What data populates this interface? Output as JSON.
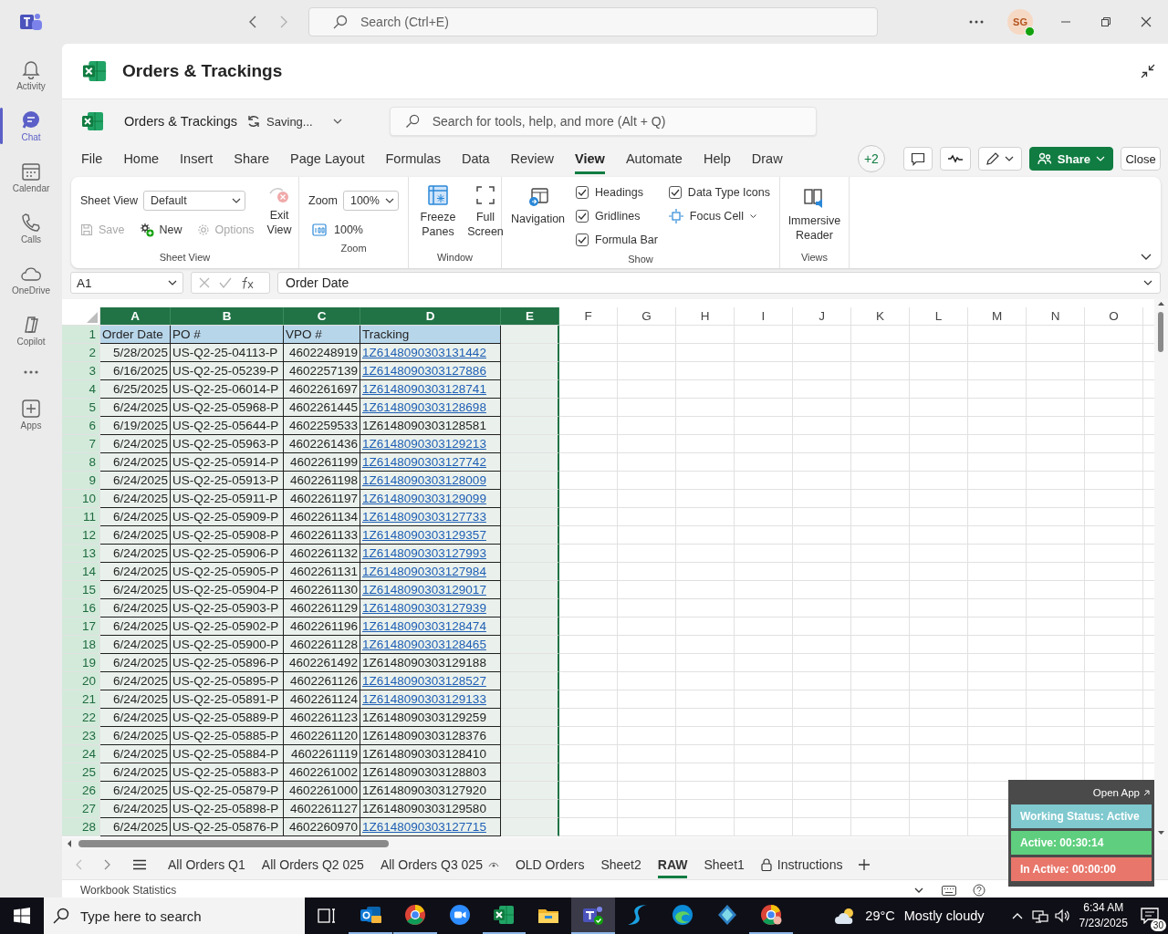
{
  "teams": {
    "search_placeholder": "Search (Ctrl+E)",
    "avatar": "SG",
    "rail": [
      {
        "label": "Activity",
        "selected": false
      },
      {
        "label": "Chat",
        "selected": true
      },
      {
        "label": "Calendar",
        "selected": false
      },
      {
        "label": "Calls",
        "selected": false
      },
      {
        "label": "OneDrive",
        "selected": false
      },
      {
        "label": "Copilot",
        "selected": false
      },
      {
        "label": "Apps",
        "selected": false
      }
    ]
  },
  "excel": {
    "title": "Orders & Trackings"
  },
  "ribbon": {
    "file_name": "Orders & Trackings",
    "save_status": "Saving...",
    "search_placeholder": "Search for tools, help, and more (Alt + Q)",
    "tabs": [
      {
        "label": "File",
        "selected": false
      },
      {
        "label": "Home",
        "selected": false
      },
      {
        "label": "Insert",
        "selected": false
      },
      {
        "label": "Share",
        "selected": false
      },
      {
        "label": "Page Layout",
        "selected": false
      },
      {
        "label": "Formulas",
        "selected": false
      },
      {
        "label": "Data",
        "selected": false
      },
      {
        "label": "Review",
        "selected": false
      },
      {
        "label": "View",
        "selected": true
      },
      {
        "label": "Automate",
        "selected": false
      },
      {
        "label": "Help",
        "selected": false
      },
      {
        "label": "Draw",
        "selected": false
      }
    ],
    "collaborators": "+2",
    "share": "Share",
    "close": "Close",
    "sheet_view": {
      "label": "Sheet View",
      "field_label": "Sheet View",
      "value": "Default",
      "exit": {
        "label": "Exit View",
        "disabled": true
      },
      "actions": [
        {
          "label": "Save",
          "disabled": true
        },
        {
          "label": "New",
          "disabled": false
        },
        {
          "label": "Options",
          "disabled": true
        }
      ]
    },
    "zoom": {
      "label": "Zoom",
      "field_label": "Zoom",
      "value": "100%",
      "reset": "100%"
    },
    "window": {
      "label": "Window",
      "freeze": "Freeze Panes",
      "full_screen": "Full Screen"
    },
    "show": {
      "label": "Show",
      "navigation": "Navigation",
      "focus_cell": "Focus Cell",
      "checkboxes": [
        {
          "label": "Headings",
          "checked": true
        },
        {
          "label": "Gridlines",
          "checked": true
        },
        {
          "label": "Formula Bar",
          "checked": true
        },
        {
          "label": "Data Type Icons",
          "checked": true
        }
      ]
    },
    "views": {
      "label": "Views",
      "immersive": "Immersive Reader"
    }
  },
  "formula_bar": {
    "name_box": "A1",
    "content": "Order Date"
  },
  "sheet": {
    "columns": [
      {
        "label": "A",
        "selected": true
      },
      {
        "label": "B",
        "selected": true
      },
      {
        "label": "C",
        "selected": true
      },
      {
        "label": "D",
        "selected": true
      },
      {
        "label": "E",
        "selected": true
      },
      {
        "label": "F",
        "selected": false
      },
      {
        "label": "G",
        "selected": false
      },
      {
        "label": "H",
        "selected": false
      },
      {
        "label": "I",
        "selected": false
      },
      {
        "label": "J",
        "selected": false
      },
      {
        "label": "K",
        "selected": false
      },
      {
        "label": "L",
        "selected": false
      },
      {
        "label": "M",
        "selected": false
      },
      {
        "label": "N",
        "selected": false
      },
      {
        "label": "O",
        "selected": false
      }
    ],
    "header_row": {
      "number": "1",
      "cells": [
        "Order Date",
        "PO #",
        "VPO #",
        "Tracking"
      ]
    },
    "rows": [
      {
        "number": "2",
        "date": "5/28/2025",
        "po": "US-Q2-25-04113-P",
        "vpo": "4602248919",
        "tracking": "1Z6148090303131442",
        "link": true
      },
      {
        "number": "3",
        "date": "6/16/2025",
        "po": "US-Q2-25-05239-P",
        "vpo": "4602257139",
        "tracking": "1Z6148090303127886",
        "link": true
      },
      {
        "number": "4",
        "date": "6/25/2025",
        "po": "US-Q2-25-06014-P",
        "vpo": "4602261697",
        "tracking": "1Z6148090303128741",
        "link": true
      },
      {
        "number": "5",
        "date": "6/24/2025",
        "po": "US-Q2-25-05968-P",
        "vpo": "4602261445",
        "tracking": "1Z6148090303128698",
        "link": true
      },
      {
        "number": "6",
        "date": "6/19/2025",
        "po": "US-Q2-25-05644-P",
        "vpo": "4602259533",
        "tracking": "1Z6148090303128581",
        "link": false
      },
      {
        "number": "7",
        "date": "6/24/2025",
        "po": "US-Q2-25-05963-P",
        "vpo": "4602261436",
        "tracking": "1Z6148090303129213",
        "link": true
      },
      {
        "number": "8",
        "date": "6/24/2025",
        "po": "US-Q2-25-05914-P",
        "vpo": "4602261199",
        "tracking": "1Z6148090303127742",
        "link": true
      },
      {
        "number": "9",
        "date": "6/24/2025",
        "po": "US-Q2-25-05913-P",
        "vpo": "4602261198",
        "tracking": "1Z6148090303128009",
        "link": true
      },
      {
        "number": "10",
        "date": "6/24/2025",
        "po": "US-Q2-25-05911-P",
        "vpo": "4602261197",
        "tracking": "1Z6148090303129099",
        "link": true
      },
      {
        "number": "11",
        "date": "6/24/2025",
        "po": "US-Q2-25-05909-P",
        "vpo": "4602261134",
        "tracking": "1Z6148090303127733",
        "link": true
      },
      {
        "number": "12",
        "date": "6/24/2025",
        "po": "US-Q2-25-05908-P",
        "vpo": "4602261133",
        "tracking": "1Z6148090303129357",
        "link": true
      },
      {
        "number": "13",
        "date": "6/24/2025",
        "po": "US-Q2-25-05906-P",
        "vpo": "4602261132",
        "tracking": "1Z6148090303127993",
        "link": true
      },
      {
        "number": "14",
        "date": "6/24/2025",
        "po": "US-Q2-25-05905-P",
        "vpo": "4602261131",
        "tracking": "1Z6148090303127984",
        "link": true
      },
      {
        "number": "15",
        "date": "6/24/2025",
        "po": "US-Q2-25-05904-P",
        "vpo": "4602261130",
        "tracking": "1Z6148090303129017",
        "link": true
      },
      {
        "number": "16",
        "date": "6/24/2025",
        "po": "US-Q2-25-05903-P",
        "vpo": "4602261129",
        "tracking": "1Z6148090303127939",
        "link": true
      },
      {
        "number": "17",
        "date": "6/24/2025",
        "po": "US-Q2-25-05902-P",
        "vpo": "4602261196",
        "tracking": "1Z6148090303128474",
        "link": true
      },
      {
        "number": "18",
        "date": "6/24/2025",
        "po": "US-Q2-25-05900-P",
        "vpo": "4602261128",
        "tracking": "1Z6148090303128465",
        "link": true
      },
      {
        "number": "19",
        "date": "6/24/2025",
        "po": "US-Q2-25-05896-P",
        "vpo": "4602261492",
        "tracking": "1Z6148090303129188",
        "link": false
      },
      {
        "number": "20",
        "date": "6/24/2025",
        "po": "US-Q2-25-05895-P",
        "vpo": "4602261126",
        "tracking": "1Z6148090303128527",
        "link": true
      },
      {
        "number": "21",
        "date": "6/24/2025",
        "po": "US-Q2-25-05891-P",
        "vpo": "4602261124",
        "tracking": "1Z6148090303129133",
        "link": true
      },
      {
        "number": "22",
        "date": "6/24/2025",
        "po": "US-Q2-25-05889-P",
        "vpo": "4602261123",
        "tracking": "1Z6148090303129259",
        "link": false
      },
      {
        "number": "23",
        "date": "6/24/2025",
        "po": "US-Q2-25-05885-P",
        "vpo": "4602261120",
        "tracking": "1Z6148090303128376",
        "link": false
      },
      {
        "number": "24",
        "date": "6/24/2025",
        "po": "US-Q2-25-05884-P",
        "vpo": "4602261119",
        "tracking": "1Z6148090303128410",
        "link": false
      },
      {
        "number": "25",
        "date": "6/24/2025",
        "po": "US-Q2-25-05883-P",
        "vpo": "4602261002",
        "tracking": "1Z6148090303128803",
        "link": false
      },
      {
        "number": "26",
        "date": "6/24/2025",
        "po": "US-Q2-25-05879-P",
        "vpo": "4602261000",
        "tracking": "1Z6148090303127920",
        "link": false
      },
      {
        "number": "27",
        "date": "6/24/2025",
        "po": "US-Q2-25-05898-P",
        "vpo": "4602261127",
        "tracking": "1Z6148090303129580",
        "link": false
      },
      {
        "number": "28",
        "date": "6/24/2025",
        "po": "US-Q2-25-05876-P",
        "vpo": "4602260970",
        "tracking": "1Z6148090303127715",
        "link": true
      }
    ]
  },
  "sheet_tabs": [
    {
      "label": "All Orders Q1",
      "kind": "plain",
      "selected": false
    },
    {
      "label": "All Orders Q2 025",
      "kind": "plain",
      "selected": false
    },
    {
      "label": "All Orders Q3 025",
      "kind": "watched",
      "selected": false
    },
    {
      "label": "OLD Orders",
      "kind": "plain",
      "selected": false
    },
    {
      "label": "Sheet2",
      "kind": "plain",
      "selected": false
    },
    {
      "label": "RAW",
      "kind": "plain",
      "selected": true
    },
    {
      "label": "Sheet1",
      "kind": "plain",
      "selected": false
    },
    {
      "label": "Instructions",
      "kind": "locked",
      "selected": false
    }
  ],
  "status_bar": {
    "text": "Workbook Statistics"
  },
  "tracker": {
    "open_app": "Open App",
    "items": [
      {
        "label": "Working Status: Active",
        "color": "#7fc9cf"
      },
      {
        "label": "Active: 00:30:14",
        "color": "#5fcf7f"
      },
      {
        "label": "In Active: 00:00:00",
        "color": "#e8766a"
      }
    ]
  },
  "taskbar": {
    "search_placeholder": "Type here to search",
    "apps": [
      {
        "running": true,
        "selected": false
      },
      {
        "running": true,
        "selected": false
      },
      {
        "running": false,
        "selected": false
      },
      {
        "running": true,
        "selected": false
      },
      {
        "running": false,
        "selected": false
      },
      {
        "running": true,
        "selected": true
      },
      {
        "running": false,
        "selected": false
      },
      {
        "running": false,
        "selected": false
      },
      {
        "running": false,
        "selected": false
      },
      {
        "running": true,
        "selected": false
      }
    ],
    "temperature": "29°C",
    "weather": "Mostly cloudy",
    "time": "6:34 AM",
    "date": "7/23/2025",
    "notifications": "30"
  }
}
